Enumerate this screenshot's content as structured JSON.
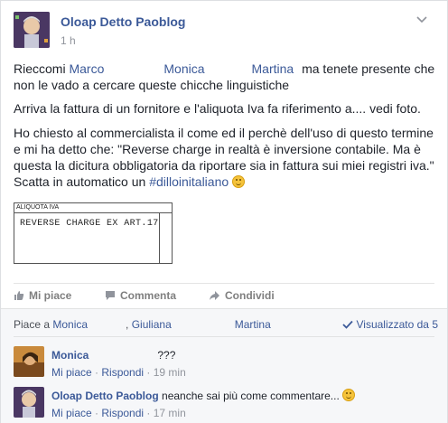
{
  "post": {
    "author": "Oloap Detto Paoblog",
    "time": "1 h",
    "para1_prefix": "Rieccomi ",
    "tags": [
      "Marco",
      "Monica",
      "Martina"
    ],
    "para1_suffix": " ma tenete presente che non le vado a cercare queste chicche linguistiche",
    "para2": "Arriva la fattura di un fornitore e l'aliquota Iva fa riferimento a.... vedi foto.",
    "para3_main": "Ho chiesto al commercialista il come ed il perchè dell'uso di questo termine e mi ha detto che: \"Reverse charge in realtà è inversione contabile. Ma è questa la dicitura obbligatoria da riportare sia in fattura sui miei registri iva.\" Scatta in automatico un ",
    "hashtag": "#dilloinitaliano",
    "photo": {
      "header": "ALIQUOTA IVA",
      "text": "REVERSE CHARGE EX ART.17"
    }
  },
  "actions": {
    "like": "Mi piace",
    "comment": "Commenta",
    "share": "Condividi"
  },
  "ufi": {
    "likes_prefix": "Piace a ",
    "likers": [
      "Monica",
      "Giuliana",
      "Martina"
    ],
    "viewed": "Visualizzato da 5"
  },
  "comments": [
    {
      "name": "Monica",
      "text": "???",
      "like": "Mi piace",
      "reply": "Rispondi",
      "time": "19 min"
    },
    {
      "name": "Oloap Detto Paoblog",
      "text": "neanche sai più come commentare...",
      "like": "Mi piace",
      "reply": "Rispondi",
      "time": "17 min"
    }
  ],
  "colors": {
    "link": "#3b5998",
    "meta": "#90949c",
    "background": "#f6f7f9"
  }
}
